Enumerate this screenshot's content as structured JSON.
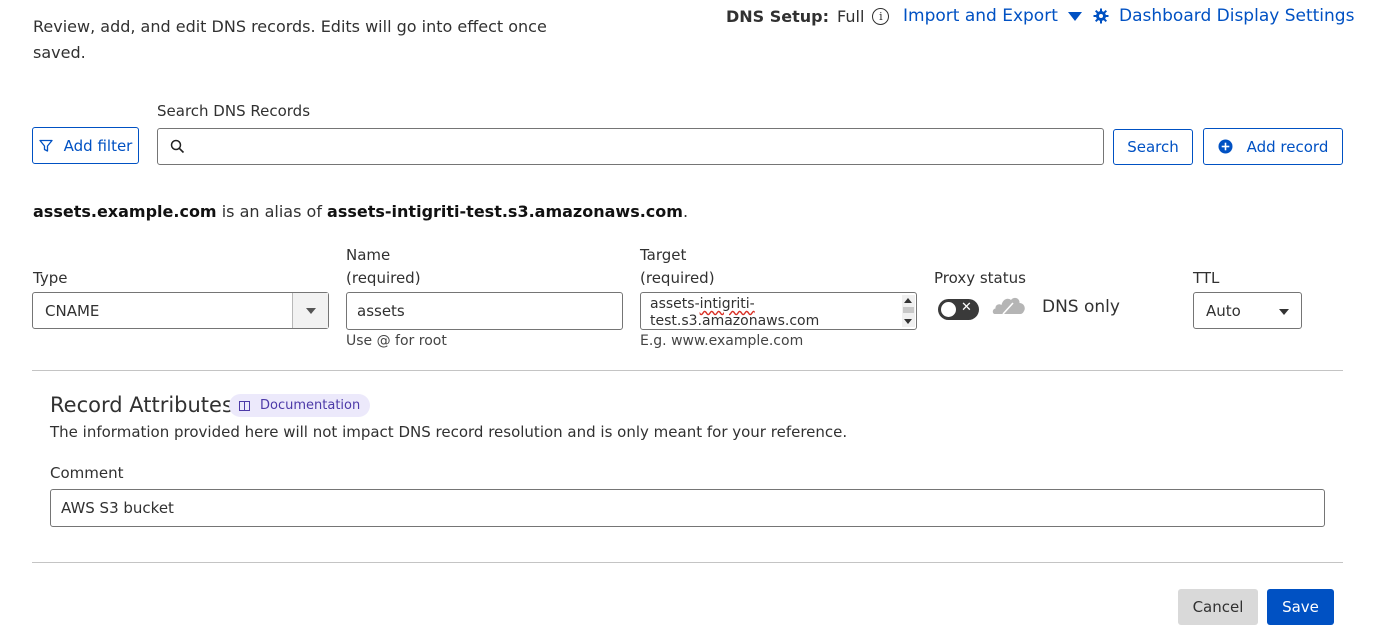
{
  "header": {
    "intro_text": "Review, add, and edit DNS records. Edits will go into effect once saved.",
    "dns_setup_label": "DNS Setup:",
    "dns_setup_value": "Full",
    "import_export_label": "Import and Export",
    "dashboard_settings_label": "Dashboard Display Settings",
    "accent_color": "#0051c3"
  },
  "search": {
    "add_filter_label": "Add filter",
    "search_label": "Search DNS Records",
    "search_value": "",
    "search_button_label": "Search",
    "add_record_label": "Add record"
  },
  "alias": {
    "name": "assets.example.com",
    "connector": "is an alias of",
    "target": "assets-intigriti-test.s3.amazonaws.com",
    "period": "."
  },
  "form": {
    "type_label": "Type",
    "type_value": "CNAME",
    "name_label": "Name",
    "name_required": "(required)",
    "name_value": "assets",
    "name_hint": "Use @ for root",
    "target_label": "Target",
    "target_required": "(required)",
    "target_value_line1": "assets-intigriti-",
    "target_value_line2": "test.s3.amazonaws.com",
    "target_hint": "E.g. www.example.com",
    "proxy_label": "Proxy status",
    "proxy_value": "DNS only",
    "proxy_toggle_on": false,
    "ttl_label": "TTL",
    "ttl_value": "Auto"
  },
  "attributes": {
    "title": "Record Attributes",
    "documentation_label": "Documentation",
    "description": "The information provided here will not impact DNS record resolution and is only meant for your reference.",
    "comment_label": "Comment",
    "comment_value": "AWS S3 bucket"
  },
  "actions": {
    "cancel_label": "Cancel",
    "save_label": "Save"
  }
}
